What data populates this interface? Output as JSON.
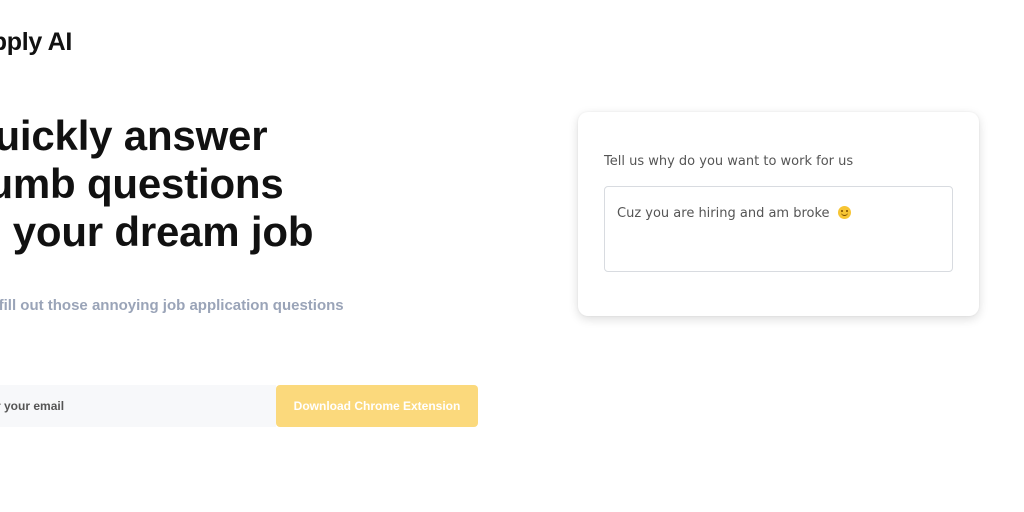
{
  "brand": {
    "name": "Apply AI"
  },
  "hero": {
    "headline_lines": [
      "Quickly answer",
      "dumb questions",
      "to your dream job"
    ],
    "subtitle": "Use Ai to fill out those annoying job application questions"
  },
  "signup": {
    "email_placeholder": "Enter your email",
    "email_value": "",
    "download_label": "Download Chrome Extension",
    "button_color": "#fbd97c"
  },
  "example_card": {
    "question": "Tell us why do you want to work for us",
    "answer": "Cuz you are hiring and am broke",
    "answer_icon": "smiling-face-emoji"
  }
}
